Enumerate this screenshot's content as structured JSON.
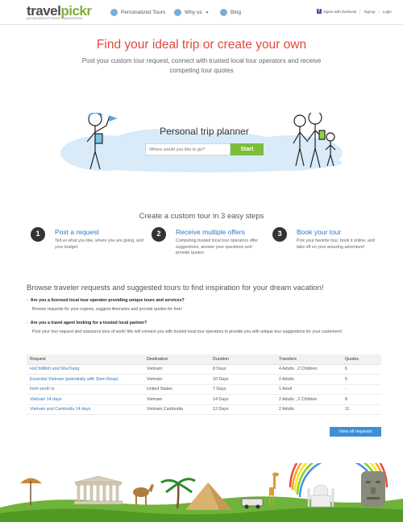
{
  "header": {
    "logo_main": "travel",
    "logo_accent": "pickr",
    "tagline": "personalized travel experiences",
    "nav": [
      {
        "label": "Personalized Tours",
        "icon": "globe-icon"
      },
      {
        "label": "Why us",
        "icon": "info-icon"
      },
      {
        "label": "Blog",
        "icon": "blog-icon"
      }
    ],
    "facebook": "Signin with facebook",
    "signup": "Signup",
    "login": "Login"
  },
  "hero": {
    "title": "Find your ideal trip or create your own",
    "subtitle": "Post your custom tour request, connect with trusted local tour operators and receive competing tour quotes"
  },
  "planner": {
    "title": "Personal trip planner",
    "placeholder": "Where would you like to go?",
    "start": "Start"
  },
  "steps": {
    "title": "Create a custom tour in 3 easy steps",
    "items": [
      {
        "num": "1",
        "title": "Post a request",
        "text": "Tell us what you like, where you are going, and your budget."
      },
      {
        "num": "2",
        "title": "Receive multiple offers",
        "text": "Competing trusted local tour operators offer suggestions, answer your questions and provide quotes."
      },
      {
        "num": "3",
        "title": "Book your tour",
        "text": "Pick your favorite tour, book it online, and take off on your amazing adventure!"
      }
    ]
  },
  "browse": {
    "title": "Browse traveler requests and suggested tours to find inspiration for your dream vacation!",
    "q1_title": "Are you a licensed local tour operator providing unique tours and services?",
    "q1_text": "Browse requests for your regions, suggest itineraries and provide quotes for free!",
    "q2_title": "Are you a travel agent looking for a trusted local partner?",
    "q2_text": "Post your tour request and outsource tons of work! We will connect you with trusted local tour operators to provide you with unique tour suggestions for your customers!"
  },
  "table": {
    "headers": [
      "Request",
      "Destination",
      "Duration",
      "Travelers",
      "Quotes"
    ],
    "rows": [
      [
        "HoChiMinh and NhaTrang",
        "Vietnam",
        "8 Days",
        "4 Adults , 2 Children",
        "6"
      ],
      [
        "Essential Vietnam (potentially with Siem Reap)",
        "Vietnam",
        "10 Days",
        "2 Adults",
        "5"
      ],
      [
        "forth worth tx",
        "United States",
        "7 Days",
        "1 Adult",
        "-"
      ],
      [
        "Vietnam 14 days",
        "Vietnam",
        "14 Days",
        "2 Adults , 2 Children",
        "8"
      ],
      [
        "Vietnam and Cambodia 14 days",
        "Vietnam,Cambodia",
        "12 Days",
        "2 Adults",
        "11"
      ]
    ],
    "view_all": "View all requests"
  }
}
